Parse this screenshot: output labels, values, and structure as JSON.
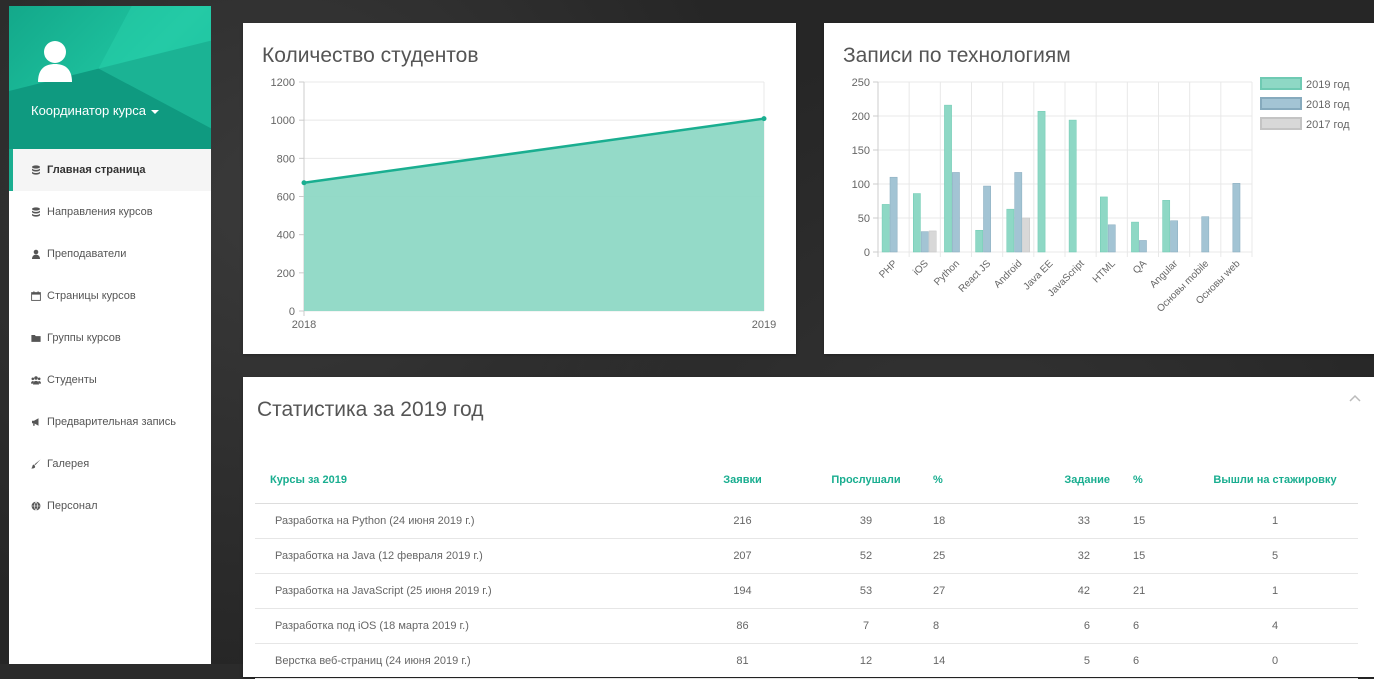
{
  "sidebar": {
    "profile": {
      "name": "Координатор курса"
    },
    "items": [
      {
        "label": "Главная страница",
        "icon": "database-icon",
        "active": true
      },
      {
        "label": "Направления курсов",
        "icon": "database-icon"
      },
      {
        "label": "Преподаватели",
        "icon": "user-icon"
      },
      {
        "label": "Страницы курсов",
        "icon": "calendar-icon"
      },
      {
        "label": "Группы курсов",
        "icon": "folder-icon"
      },
      {
        "label": "Студенты",
        "icon": "users-icon"
      },
      {
        "label": "Предварительная запись",
        "icon": "bullhorn-icon"
      },
      {
        "label": "Галерея",
        "icon": "paint-brush-icon"
      },
      {
        "label": "Персонал",
        "icon": "globe-icon"
      }
    ]
  },
  "students_card": {
    "title": "Количество студентов"
  },
  "tech_card": {
    "title": "Записи по технологиям"
  },
  "stats": {
    "title": "Статистика за 2019 год",
    "headers": [
      "Курсы за 2019",
      "Заявки",
      "Прослушали",
      "%",
      "Задание",
      "%",
      "Вышли на стажировку"
    ],
    "rows": [
      [
        "Разработка на Python (24 июня 2019 г.)",
        "216",
        "39",
        "18",
        "33",
        "15",
        "1"
      ],
      [
        "Разработка на Java (12 февраля 2019 г.)",
        "207",
        "52",
        "25",
        "32",
        "15",
        "5"
      ],
      [
        "Разработка на JavaScript (25 июня 2019 г.)",
        "194",
        "53",
        "27",
        "42",
        "21",
        "1"
      ],
      [
        "Разработка под iOS (18 марта 2019 г.)",
        "86",
        "7",
        "8",
        "6",
        "6",
        "4"
      ],
      [
        "Верстка веб-страниц (24 июня 2019 г.)",
        "81",
        "12",
        "14",
        "5",
        "6",
        "0"
      ]
    ]
  },
  "colors": {
    "accent": "#1aae90",
    "s2019": "#8ed8c5",
    "s2018": "#a3c4d4",
    "s2017": "#d8d8d8"
  },
  "chart_data": [
    {
      "type": "area",
      "title": "Количество студентов",
      "x": [
        "2018",
        "2019"
      ],
      "values": [
        672,
        1008
      ],
      "ylim": [
        0,
        1200
      ],
      "yticks": [
        "0",
        "200",
        "400",
        "600",
        "800",
        "1000",
        "1200"
      ],
      "grid": true
    },
    {
      "type": "bar",
      "title": "Записи по технологиям",
      "categories": [
        "PHP",
        "iOS",
        "Python",
        "React JS",
        "Android",
        "Java EE",
        "JavaScript",
        "HTML",
        "QA",
        "Angular",
        "Основы mobile",
        "Основы web"
      ],
      "series": [
        {
          "name": "2019 год",
          "values": [
            70,
            86,
            216,
            32,
            63,
            207,
            194,
            81,
            44,
            76,
            0,
            0
          ]
        },
        {
          "name": "2018 год",
          "values": [
            110,
            30,
            117,
            97,
            117,
            0,
            0,
            40,
            17,
            46,
            52,
            101
          ]
        },
        {
          "name": "2017 год",
          "values": [
            0,
            31,
            0,
            0,
            50,
            0,
            0,
            0,
            0,
            0,
            0,
            0
          ]
        }
      ],
      "ylim": [
        0,
        250
      ],
      "yticks": [
        "0",
        "50",
        "100",
        "150",
        "200",
        "250"
      ],
      "legend": "top-right",
      "grid": true
    }
  ]
}
